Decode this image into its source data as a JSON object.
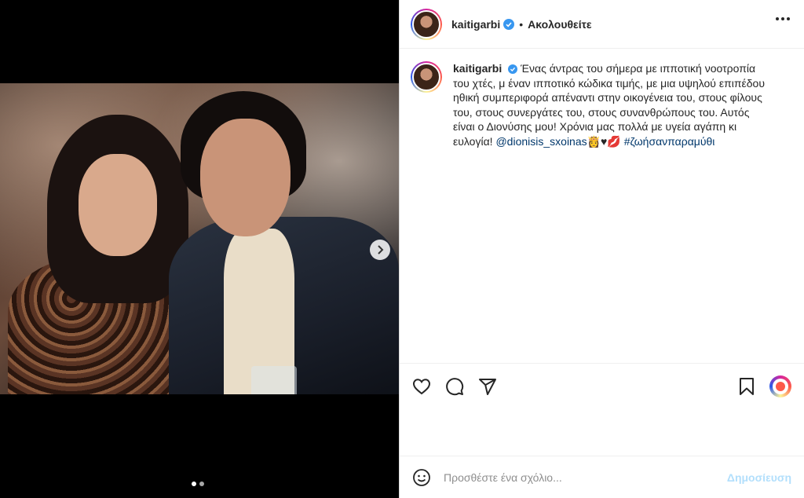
{
  "post": {
    "username": "kaitigarbi",
    "separator": "•",
    "follow_label": "Ακολουθείτε",
    "caption_text": "Ένας άντρας του σήμερα με ιπποτική νοοτροπία του χτές, μ έναν ιπποτικό κώδικα τιμής, με μια υψηλού επιπέδου ηθική συμπεριφορά απέναντι στην οικογένεια του, στους φίλους του, στους συνεργάτες του, στους συνανθρώπους του. Αυτός είναι ο Διονύσης μου! Χρόνια μας πολλά με υγεία αγάπη κι ευλογία! ",
    "mention": "@dionisis_sxoinas",
    "emojis": "👸♥💋",
    "hashtag": "#ζωήσανπαραμύθι"
  },
  "carousel": {
    "count": 2,
    "active_index": 0
  },
  "comment": {
    "placeholder": "Προσθέστε ένα σχόλιο...",
    "post_label": "Δημοσίευση"
  },
  "colors": {
    "verified": "#3897f0",
    "link": "#00376b",
    "post_disabled": "#b2dffc"
  },
  "icons": [
    "more-options-icon",
    "verified-icon",
    "heart-icon",
    "comment-icon",
    "share-icon",
    "bookmark-icon",
    "emoji-icon",
    "chevron-right-icon"
  ]
}
